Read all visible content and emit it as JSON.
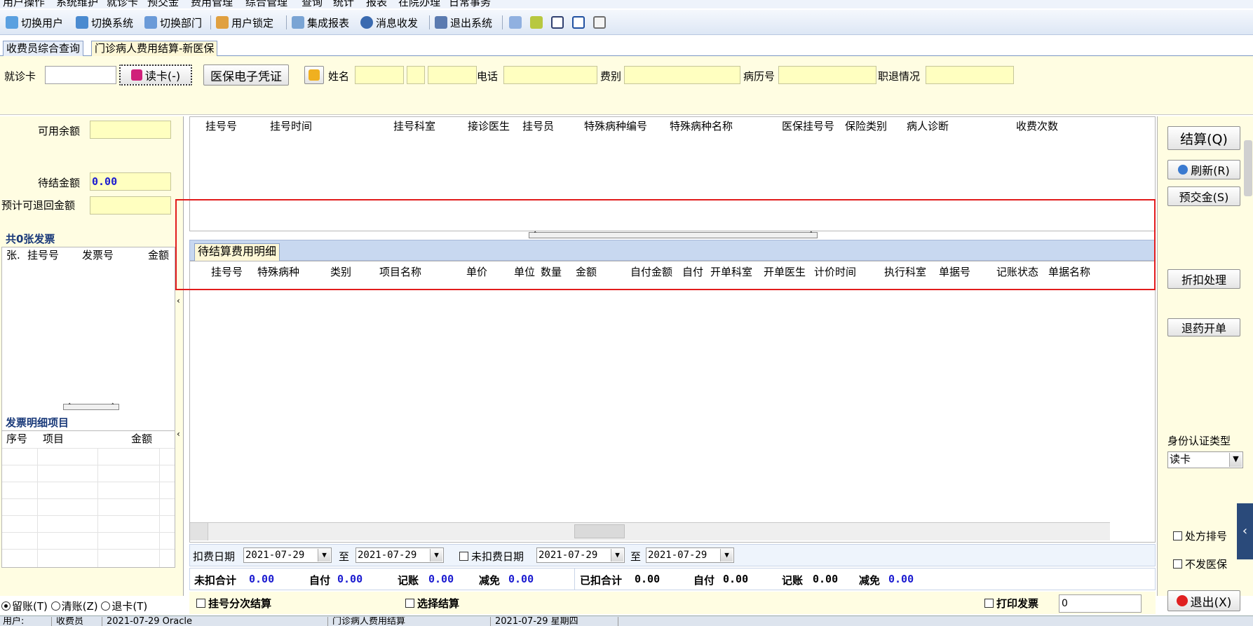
{
  "menu": [
    "用户操作",
    "系统维护",
    "就诊卡",
    "预交金",
    "费用管理",
    "综合管理",
    "查询",
    "统计",
    "报表",
    "在院办理",
    "日常事务"
  ],
  "toolbar": {
    "switch_user": "切换用户",
    "switch_system": "切换系统",
    "switch_dept": "切换部门",
    "lock_user": "用户锁定",
    "integrated_report": "集成报表",
    "message": "消息收发",
    "exit_system": "退出系统"
  },
  "tabs": [
    "收费员综合查询",
    "门诊病人费用结算-新医保"
  ],
  "patient": {
    "card_label": "就诊卡",
    "read_card_button": "读卡(-)",
    "e_voucher_button": "医保电子凭证",
    "name_label": "姓名",
    "phone_label": "电话",
    "fee_type_label": "费别",
    "record_no_label": "病历号",
    "status_label": "职退情况"
  },
  "left": {
    "balance_label": "可用余额",
    "pending_amount_label": "待结金额",
    "pending_amount_value": "0.00",
    "refund_label": "预计可退回金额",
    "invoice_count_title": "共0张发票",
    "invoice_cols": [
      "张.",
      "挂号号",
      "发票号",
      "金额"
    ],
    "invoice_detail_title": "发票明细项目",
    "detail_cols": [
      "序号",
      "项目",
      "金额"
    ],
    "mode_options": [
      "留账(T)",
      "清账(Z)",
      "退卡(T)"
    ]
  },
  "registration_cols": [
    "挂号号",
    "挂号时间",
    "挂号科室",
    "接诊医生",
    "挂号员",
    "特殊病种编号",
    "特殊病种名称",
    "医保挂号号",
    "保险类别",
    "病人诊断",
    "收费次数"
  ],
  "detail_tab": "待结算费用明细",
  "detail_cols": [
    "挂号号",
    "特殊病种",
    "类别",
    "项目名称",
    "单价",
    "单位",
    "数量",
    "金额",
    "自付金额",
    "自付",
    "开单科室",
    "开单医生",
    "计价时间",
    "执行科室",
    "单据号",
    "记账状态",
    "单据名称"
  ],
  "filters": {
    "charge_date_label": "扣费日期",
    "from1": "2021-07-29",
    "to_label": "至",
    "to1": "2021-07-29",
    "uncharged_date_label": "未扣费日期",
    "from2": "2021-07-29",
    "to2": "2021-07-29"
  },
  "totals": {
    "uncharged_label": "未扣合计",
    "uncharged_value": "0.00",
    "self_label": "自付",
    "self_value": "0.00",
    "credit_label": "记账",
    "credit_value": "0.00",
    "reduce_label": "减免",
    "reduce_value": "0.00",
    "charged_label": "已扣合计",
    "charged_value": "0.00",
    "self2_value": "0.00",
    "credit2_value": "0.00",
    "reduce2_value": "0.00"
  },
  "bottom": {
    "reg_split": "挂号分次结算",
    "select_settle": "选择结算",
    "print_invoice": "打印发票",
    "print_count": "0"
  },
  "right": {
    "settle_button": "结算(Q)",
    "refresh_button": "刷新(R)",
    "prepay_button": "预交金(S)",
    "discount_button": "折扣处理",
    "return_drug_button": "退药开单",
    "id_type_label": "身份认证类型",
    "id_type_value": "读卡",
    "rx_sort": "处方排号",
    "no_insurance": "不发医保",
    "exit_button": "退出(X)"
  },
  "status": [
    "用户:",
    "收费员",
    "2021-07-29 Oracle",
    "",
    "门诊病人费用结算",
    "2021-07-29 星期四"
  ],
  "colors": {
    "accent_yellow": "#ffffc0",
    "panel_bg": "#fffde2",
    "highlight_red": "#e21c1c",
    "value_blue": "#1b1bd0"
  }
}
